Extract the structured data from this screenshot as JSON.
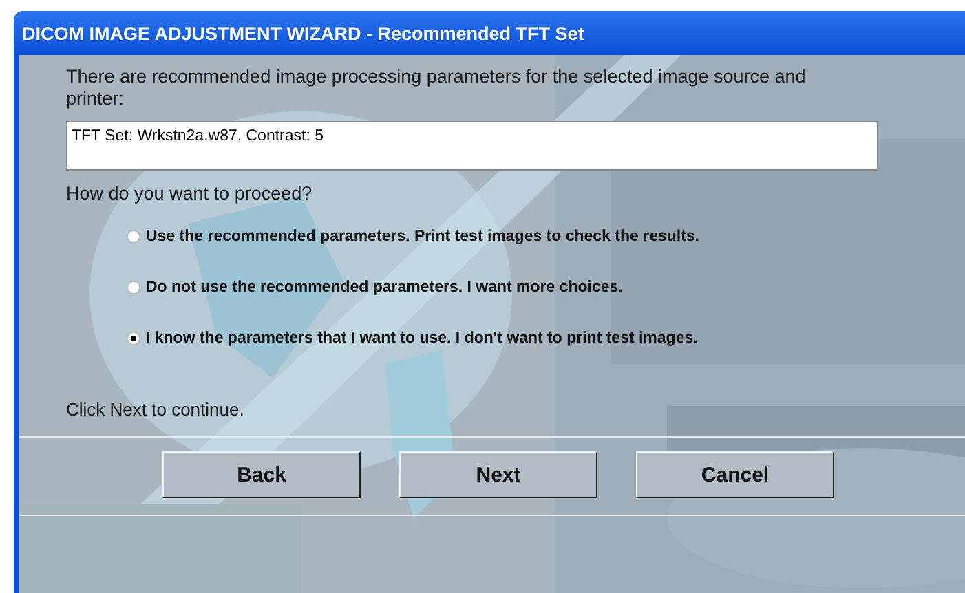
{
  "window": {
    "title": "DICOM IMAGE ADJUSTMENT WIZARD - Recommended TFT Set"
  },
  "intro": "There are recommended image processing parameters for the selected image source and printer:",
  "recommendation": {
    "value": "TFT Set: Wrkstn2a.w87, Contrast: 5"
  },
  "question": "How do you want to proceed?",
  "options": [
    {
      "label": "Use the recommended parameters. Print test images to check the results.",
      "selected": false
    },
    {
      "label": "Do not use the recommended parameters. I want more choices.",
      "selected": false
    },
    {
      "label": "I know the parameters that I want to use. I don't want to print test images.",
      "selected": true
    }
  ],
  "hint": "Click Next to continue.",
  "buttons": [
    "Back",
    "Next",
    "Cancel"
  ]
}
